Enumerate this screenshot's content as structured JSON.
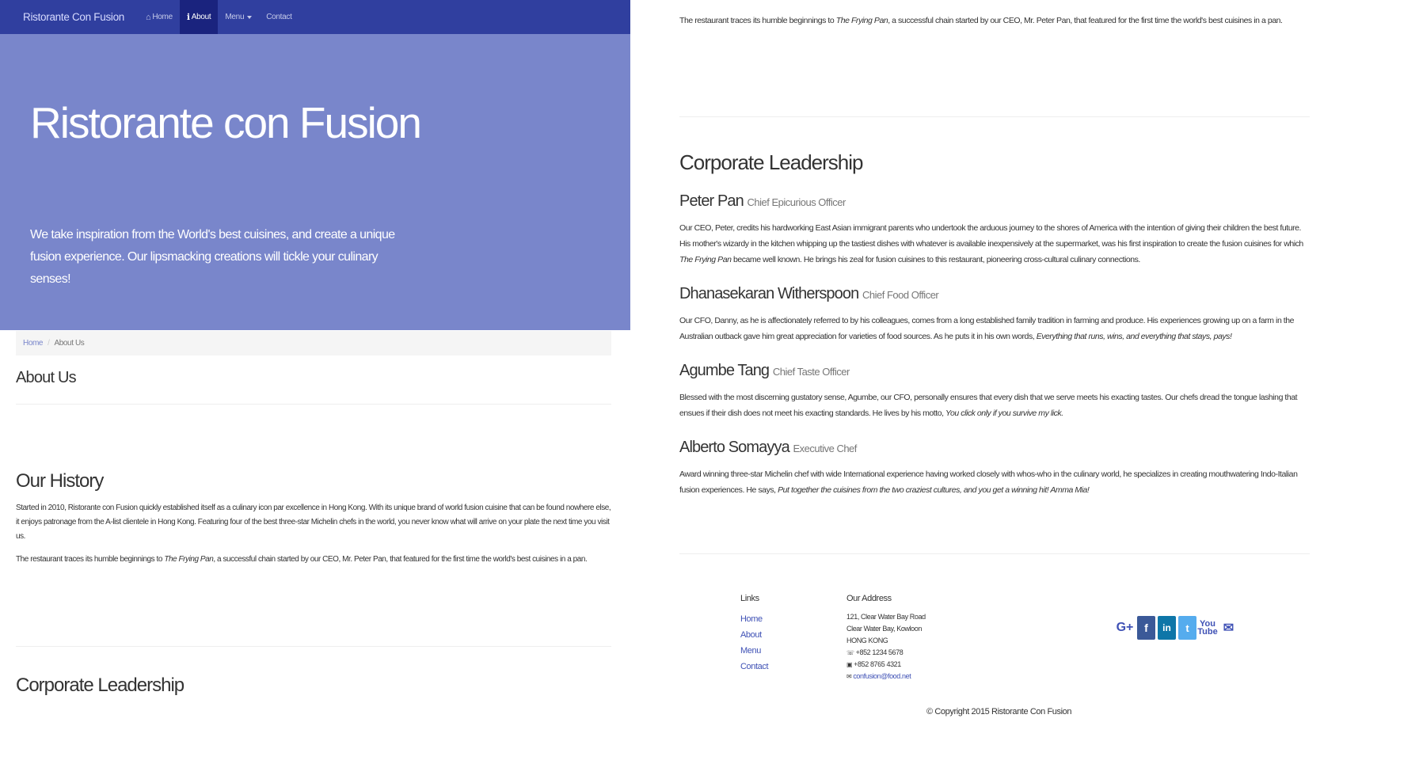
{
  "navbar": {
    "brand": "Ristorante Con Fusion",
    "items": [
      {
        "icon": "home-icon",
        "glyph": "⌂",
        "label": "Home"
      },
      {
        "icon": "info-icon",
        "glyph": "ℹ",
        "label": "About"
      },
      {
        "label": "Menu"
      },
      {
        "label": "Contact"
      }
    ]
  },
  "jumbotron": {
    "title": "Ristorante con Fusion",
    "text": "We take inspiration from the World's best cuisines, and create a unique fusion experience. Our lipsmacking creations will tickle your culinary senses!"
  },
  "breadcrumb": {
    "home": "Home",
    "separator": "/",
    "current": "About Us"
  },
  "page": {
    "heading": "About Us",
    "history_heading": "Our History",
    "history_p1": "Started in 2010, Ristorante con Fusion quickly established itself as a culinary icon par excellence in Hong Kong. With its unique brand of world fusion cuisine that can be found nowhere else, it enjoys patronage from the A-list clientele in Hong Kong. Featuring four of the best three-star Michelin chefs in the world, you never know what will arrive on your plate the next time you visit us.",
    "history_p2_pre": "The restaurant traces its humble beginnings to ",
    "history_p2_em": "The Frying Pan",
    "history_p2_post": ", a successful chain started by our CEO, Mr. Peter Pan, that featured for the first time the world's best cuisines in a pan.",
    "leadership_heading": "Corporate Leadership"
  },
  "leaders": [
    {
      "name": "Peter Pan",
      "title": "Chief Epicurious Officer",
      "bio_pre": "Our CEO, Peter, credits his hardworking East Asian immigrant parents who undertook the arduous journey to the shores of America with the intention of giving their children the best future. His mother's wizardy in the kitchen whipping up the tastiest dishes with whatever is available inexpensively at the supermarket, was his first inspiration to create the fusion cuisines for which ",
      "bio_em": "The Frying Pan",
      "bio_post": " became well known. He brings his zeal for fusion cuisines to this restaurant, pioneering cross-cultural culinary connections."
    },
    {
      "name": "Dhanasekaran Witherspoon",
      "title": "Chief Food Officer",
      "bio_pre": "Our CFO, Danny, as he is affectionately referred to by his colleagues, comes from a long established family tradition in farming and produce. His experiences growing up on a farm in the Australian outback gave him great appreciation for varieties of food sources. As he puts it in his own words, ",
      "bio_em": "Everything that runs, wins, and everything that stays, pays!",
      "bio_post": ""
    },
    {
      "name": "Agumbe Tang",
      "title": "Chief Taste Officer",
      "bio_pre": "Blessed with the most discerning gustatory sense, Agumbe, our CFO, personally ensures that every dish that we serve meets his exacting tastes. Our chefs dread the tongue lashing that ensues if their dish does not meet his exacting standards. He lives by his motto, ",
      "bio_em": "You click only if you survive my lick.",
      "bio_post": ""
    },
    {
      "name": "Alberto Somayya",
      "title": "Executive Chef",
      "bio_pre": "Award winning three-star Michelin chef with wide International experience having worked closely with whos-who in the culinary world, he specializes in creating mouthwatering Indo-Italian fusion experiences. He says, ",
      "bio_em": "Put together the cuisines from the two craziest cultures, and you get a winning hit! Amma Mia!",
      "bio_post": ""
    }
  ],
  "footer": {
    "links_heading": "Links",
    "links": [
      "Home",
      "About",
      "Menu",
      "Contact"
    ],
    "address_heading": "Our Address",
    "address_lines": [
      "121, Clear Water Bay Road",
      "Clear Water Bay, Kowloon",
      "HONG KONG"
    ],
    "phone": "+852 1234 5678",
    "fax": "+852 8765 4321",
    "email": "confusion@food.net",
    "social": {
      "gplus": "G+",
      "facebook": "f",
      "linkedin": "in",
      "twitter": "t",
      "youtube": "You Tube",
      "mail": "✉"
    },
    "copyright_icon": "©",
    "copyright": "Copyright 2015 Ristorante Con Fusion"
  }
}
